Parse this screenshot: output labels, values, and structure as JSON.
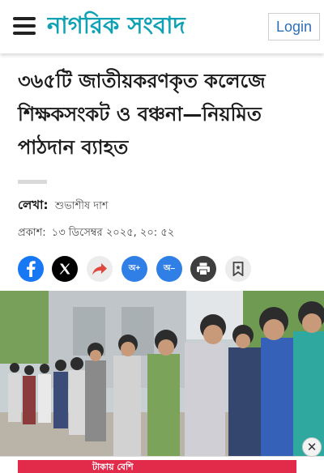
{
  "header": {
    "logo": "নাগরিক সংবাদ",
    "login_label": "Login"
  },
  "article": {
    "headline": "৩৬৫টি জাতীয়করণকৃত কলেজে শিক্ষকসংকট ও বঞ্চনা—নিয়মিত পাঠদান ব্যাহত",
    "author_label": "লেখা:",
    "author_name": "শুভাশীষ দাশ",
    "published_label": "প্রকাশ:",
    "published_value": "১৩ ডিসেম্বর ২০২৫, ২০: ৫২"
  },
  "share": {
    "font_plus": "অ+",
    "font_minus": "অ–"
  },
  "colors": {
    "brand": "#10a2b4",
    "login_text": "#2d6fb5",
    "facebook": "#1877f2",
    "font_btn": "#2f7fe6",
    "ad": "#e22b4a"
  },
  "ad": {
    "text": "টাকায় বেশি"
  },
  "icons": [
    "hamburger-menu-icon",
    "facebook-icon",
    "x-icon",
    "share-icon",
    "print-icon",
    "bookmark-icon",
    "close-icon"
  ]
}
